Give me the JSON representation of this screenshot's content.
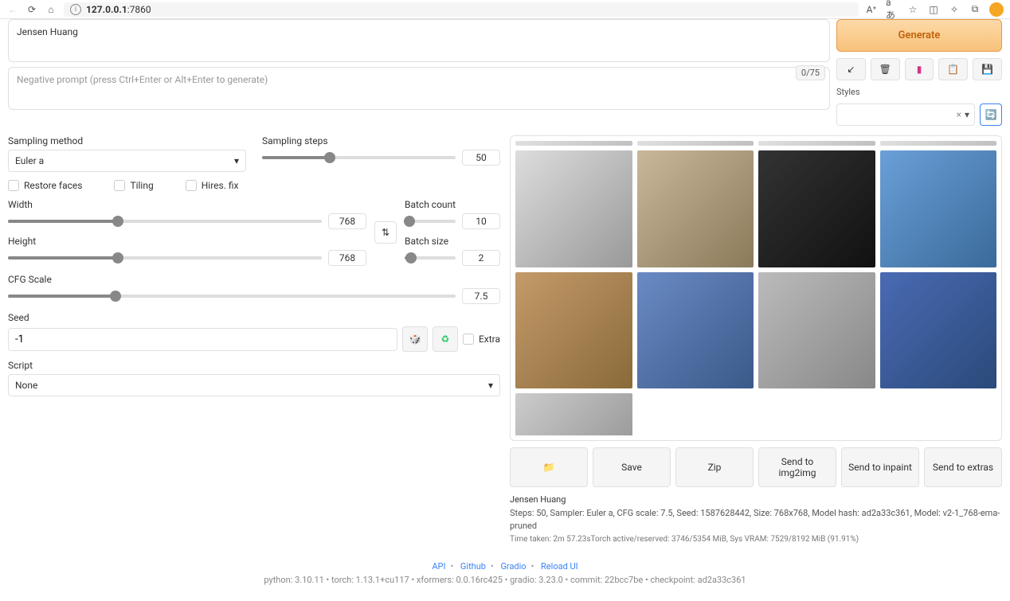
{
  "browser": {
    "url_host": "127.0.0.1",
    "url_port": ":7860"
  },
  "prompt": {
    "value": "Jensen Huang",
    "neg_placeholder": "Negative prompt (press Ctrl+Enter or Alt+Enter to generate)",
    "counter": "0/75"
  },
  "generate": {
    "label": "Generate"
  },
  "styles": {
    "label": "Styles"
  },
  "sampling": {
    "method_label": "Sampling method",
    "method_value": "Euler a",
    "steps_label": "Sampling steps",
    "steps_value": "50"
  },
  "checks": {
    "restore": "Restore faces",
    "tiling": "Tiling",
    "hires": "Hires. fix"
  },
  "dims": {
    "width_label": "Width",
    "width_value": "768",
    "height_label": "Height",
    "height_value": "768"
  },
  "batch": {
    "count_label": "Batch count",
    "count_value": "10",
    "size_label": "Batch size",
    "size_value": "2"
  },
  "cfg": {
    "label": "CFG Scale",
    "value": "7.5"
  },
  "seed": {
    "label": "Seed",
    "value": "-1",
    "extra": "Extra"
  },
  "script": {
    "label": "Script",
    "value": "None"
  },
  "output": {
    "folder": "📁",
    "save": "Save",
    "zip": "Zip",
    "img2img": "Send to img2img",
    "inpaint": "Send to inpaint",
    "extras": "Send to extras"
  },
  "info": {
    "prompt": "Jensen Huang",
    "params": "Steps: 50, Sampler: Euler a, CFG scale: 7.5, Seed: 1587628442, Size: 768x768, Model hash: ad2a33c361, Model: v2-1_768-ema-pruned",
    "timing": "Time taken: 2m 57.23sTorch active/reserved: 3746/5354 MiB, Sys VRAM: 7529/8192 MiB (91.91%)"
  },
  "footer": {
    "api": "API",
    "github": "Github",
    "gradio": "Gradio",
    "reload": "Reload UI",
    "meta": "python: 3.10.11  •  torch: 1.13.1+cu117  •  xformers: 0.0.16rc425  •  gradio: 3.23.0  •  commit: 22bcc7be  •  checkpoint: ad2a33c361"
  }
}
